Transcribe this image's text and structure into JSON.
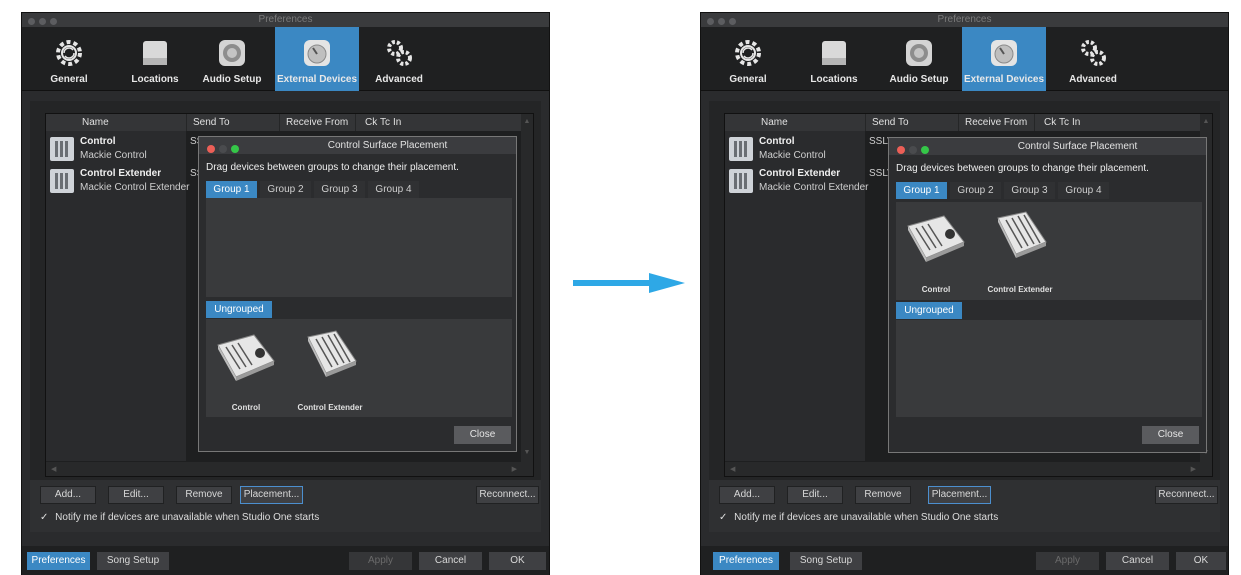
{
  "window": {
    "title": "Preferences",
    "traffic": [
      "#5c5d60",
      "#5c5d60",
      "#5c5d60"
    ]
  },
  "toolbar": {
    "items": [
      {
        "label": "General",
        "icon": "gear-icon"
      },
      {
        "label": "Locations",
        "icon": "drive-icon"
      },
      {
        "label": "Audio Setup",
        "icon": "speaker-icon"
      },
      {
        "label": "External Devices",
        "icon": "knob-icon",
        "active": true
      },
      {
        "label": "Advanced",
        "icon": "gears-icon"
      }
    ]
  },
  "table": {
    "columns": [
      "Name",
      "Send To",
      "Receive From",
      "Ck",
      "Tc",
      "In"
    ],
    "devices": [
      {
        "name": "Control",
        "model": "Mackie Control",
        "send_to": "SSLV-"
      },
      {
        "name": "Control Extender",
        "model": "Mackie Control Extender",
        "send_to": "SSLV-"
      }
    ]
  },
  "buttons": {
    "add": "Add...",
    "edit": "Edit...",
    "remove": "Remove",
    "placement": "Placement...",
    "reconnect": "Reconnect..."
  },
  "notify": {
    "checked": "✓",
    "label": "Notify me if devices are unavailable when Studio One starts"
  },
  "bottom": {
    "preferences": "Preferences",
    "song_setup": "Song Setup",
    "apply": "Apply",
    "cancel": "Cancel",
    "ok": "OK"
  },
  "dialog": {
    "title": "Control Surface Placement",
    "instruction": "Drag devices between groups to change their placement.",
    "tabs": [
      "Group 1",
      "Group 2",
      "Group 3",
      "Group 4"
    ],
    "ungrouped": "Ungrouped",
    "devices": [
      "Control",
      "Control Extender"
    ],
    "close": "Close",
    "traffic": [
      "#ec5f57",
      "#4a4b4e",
      "#35c648"
    ]
  },
  "colors": {
    "accent": "#3b88c3",
    "arrow": "#2ea8e6"
  }
}
